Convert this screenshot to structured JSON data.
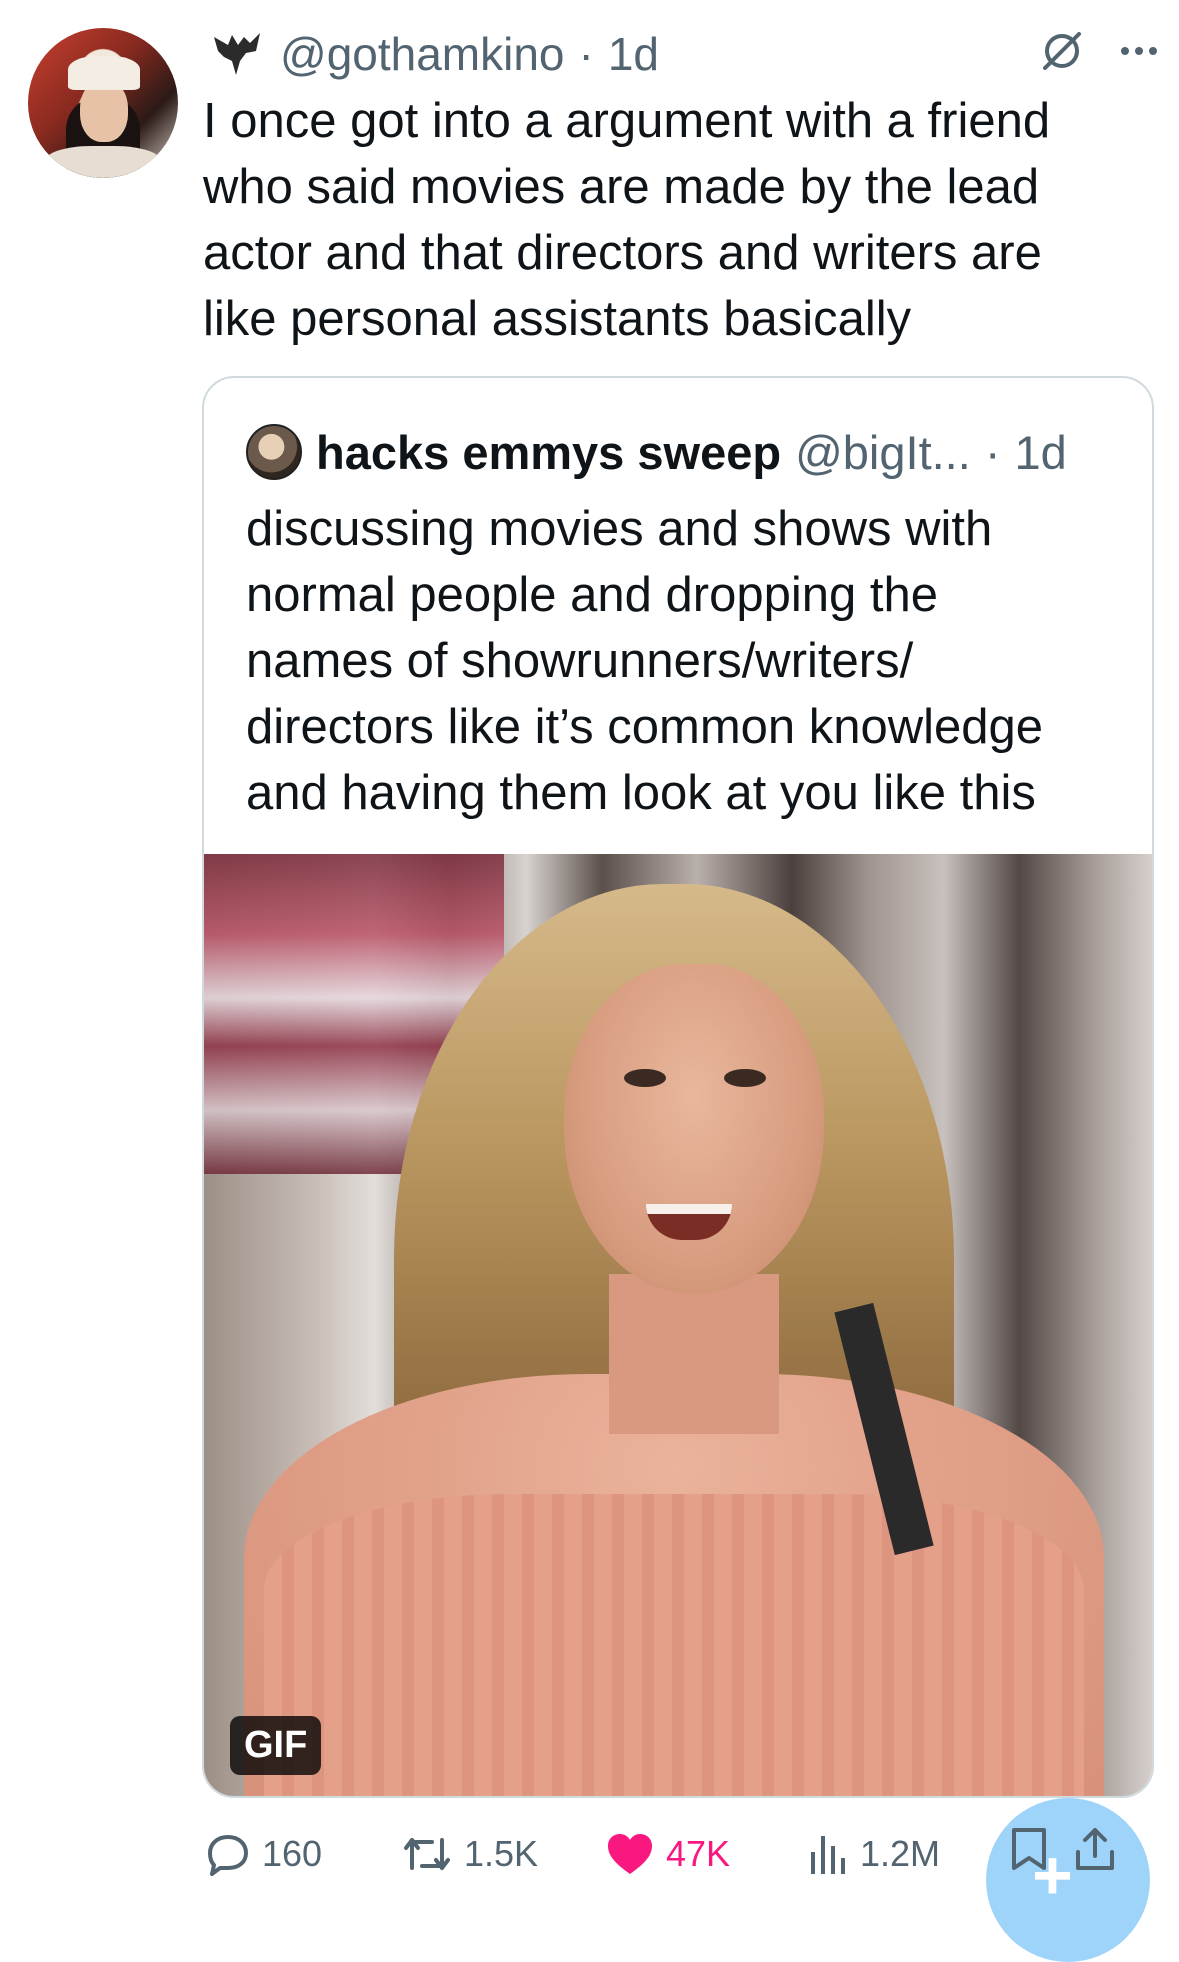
{
  "tweet": {
    "handle": "@gothamkino",
    "separator": "·",
    "time": "1d",
    "text": "I once got into a argument with a friend\nwho said movies are made by the lead\nactor and that directors and writers are\nlike personal assistants basically"
  },
  "quote": {
    "name": "hacks emmys sweep",
    "handle": "@bigIt...",
    "separator": "·",
    "time": "1d",
    "text": "discussing movies and shows with\nnormal people and dropping the\nnames of showrunners/writers/\ndirectors like it’s common knowledge\nand having them look at you like this",
    "media_badge": "GIF"
  },
  "actions": {
    "replies": "160",
    "reposts": "1.5K",
    "likes": "47K",
    "views": "1.2M"
  },
  "colors": {
    "text": "#0f1419",
    "secondary": "#536471",
    "like": "#f91880",
    "border": "#cfd9de",
    "fab": "#8ecdf8"
  },
  "icons": [
    "bat-icon",
    "grok-icon",
    "more-icon",
    "reply-icon",
    "repost-icon",
    "like-icon",
    "views-icon",
    "bookmark-icon",
    "share-icon",
    "compose-plus-icon"
  ]
}
